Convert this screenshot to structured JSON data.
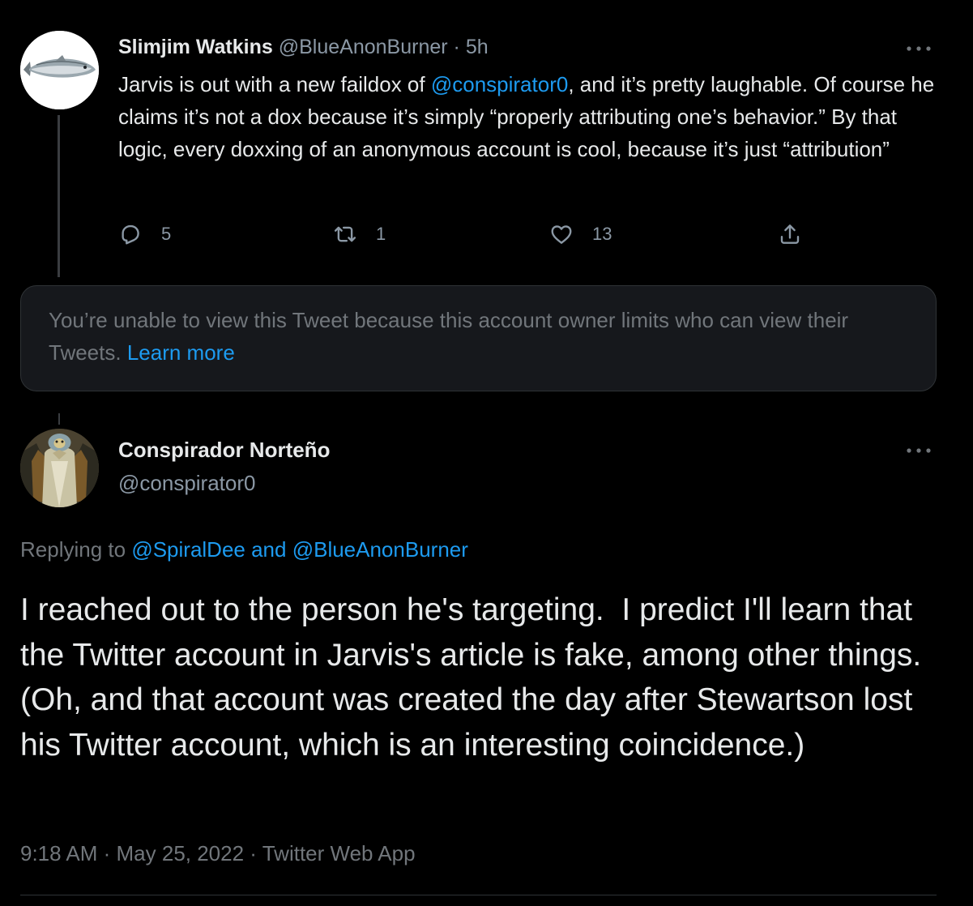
{
  "parent_tweet": {
    "display_name": "Slimjim Watkins",
    "handle": "@BlueAnonBurner",
    "separator": "·",
    "time_ago": "5h",
    "more_icon": "more-dots-icon",
    "text": {
      "part1": "Jarvis is out with a new faildox of ",
      "mention": "@conspirator0",
      "part2": ", and it’s pretty laughable. Of course he claims it’s not a dox because it’s simply “properly attributing one’s behavior.” By that logic, every doxxing of an anonymous account is cool, because it’s just “attribution”"
    },
    "actions": {
      "reply": {
        "icon": "reply-icon",
        "count": "5"
      },
      "retweet": {
        "icon": "retweet-icon",
        "count": "1"
      },
      "like": {
        "icon": "heart-icon",
        "count": "13"
      },
      "share": {
        "icon": "share-icon"
      }
    }
  },
  "unavailable_notice": {
    "text": "You’re unable to view this Tweet because this account owner limits who can view their Tweets. ",
    "link": "Learn more"
  },
  "main_tweet": {
    "display_name": "Conspirador Norteño",
    "handle": "@conspirator0",
    "more_icon": "more-dots-icon",
    "replying_prefix": "Replying to ",
    "replying_mention1": "@SpiralDee",
    "replying_and": " and ",
    "replying_mention2": "@BlueAnonBurner",
    "text": "I reached out to the person he's targeting.  I predict I'll learn that the Twitter account in Jarvis's article is fake, among other things.  (Oh, and that account was created the day after Stewartson lost his Twitter account, which is an interesting coincidence.)",
    "time": "9:18 AM",
    "date": "May 25, 2022",
    "source": "Twitter Web App",
    "dot": " · "
  },
  "colors": {
    "background": "#000000",
    "text": "#e7e9ea",
    "secondary": "#71767b",
    "link": "#1d9bf0"
  }
}
